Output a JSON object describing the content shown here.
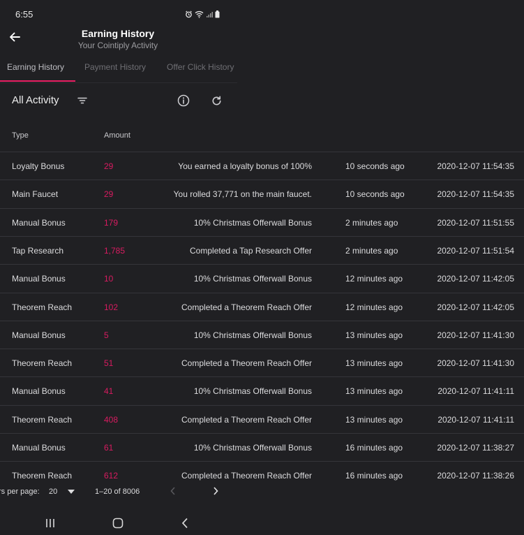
{
  "status_bar": {
    "time": "6:55",
    "icons": [
      "alarm-icon",
      "wifi-icon",
      "signal-icon",
      "battery-icon"
    ]
  },
  "header": {
    "title": "Earning History",
    "subtitle": "Your Cointiply Activity"
  },
  "tabs": [
    {
      "label": "Earning History",
      "active": true
    },
    {
      "label": "Payment History",
      "active": false
    },
    {
      "label": "Offer Click History",
      "active": false
    }
  ],
  "toolbar": {
    "filter_label": "All Activity"
  },
  "table": {
    "columns": {
      "type": "Type",
      "amount": "Amount"
    },
    "rows": [
      {
        "type": "Loyalty Bonus",
        "amount": "29",
        "desc": "You earned a loyalty bonus of 100%",
        "ago": "10 seconds ago",
        "date": "2020-12-07 11:54:35"
      },
      {
        "type": "Main Faucet",
        "amount": "29",
        "desc": "You rolled 37,771 on the main faucet.",
        "ago": "10 seconds ago",
        "date": "2020-12-07 11:54:35"
      },
      {
        "type": "Manual Bonus",
        "amount": "179",
        "desc": "10% Christmas Offerwall Bonus",
        "ago": "2 minutes ago",
        "date": "2020-12-07 11:51:55"
      },
      {
        "type": "Tap Research",
        "amount": "1,785",
        "desc": "Completed a Tap Research Offer",
        "ago": "2 minutes ago",
        "date": "2020-12-07 11:51:54"
      },
      {
        "type": "Manual Bonus",
        "amount": "10",
        "desc": "10% Christmas Offerwall Bonus",
        "ago": "12 minutes ago",
        "date": "2020-12-07 11:42:05"
      },
      {
        "type": "Theorem Reach",
        "amount": "102",
        "desc": "Completed a Theorem Reach Offer",
        "ago": "12 minutes ago",
        "date": "2020-12-07 11:42:05"
      },
      {
        "type": "Manual Bonus",
        "amount": "5",
        "desc": "10% Christmas Offerwall Bonus",
        "ago": "13 minutes ago",
        "date": "2020-12-07 11:41:30"
      },
      {
        "type": "Theorem Reach",
        "amount": "51",
        "desc": "Completed a Theorem Reach Offer",
        "ago": "13 minutes ago",
        "date": "2020-12-07 11:41:30"
      },
      {
        "type": "Manual Bonus",
        "amount": "41",
        "desc": "10% Christmas Offerwall Bonus",
        "ago": "13 minutes ago",
        "date": "2020-12-07 11:41:11"
      },
      {
        "type": "Theorem Reach",
        "amount": "408",
        "desc": "Completed a Theorem Reach Offer",
        "ago": "13 minutes ago",
        "date": "2020-12-07 11:41:11"
      },
      {
        "type": "Manual Bonus",
        "amount": "61",
        "desc": "10% Christmas Offerwall Bonus",
        "ago": "16 minutes ago",
        "date": "2020-12-07 11:38:27"
      },
      {
        "type": "Theorem Reach",
        "amount": "612",
        "desc": "Completed a Theorem Reach Offer",
        "ago": "16 minutes ago",
        "date": "2020-12-07 11:38:26"
      }
    ]
  },
  "pagination": {
    "rows_per_page_label": "rs per page:",
    "rows_per_page_value": "20",
    "range": "1–20 of 8006"
  },
  "colors": {
    "accent": "#e91e63",
    "amount": "#d81b60",
    "background": "#202023"
  }
}
